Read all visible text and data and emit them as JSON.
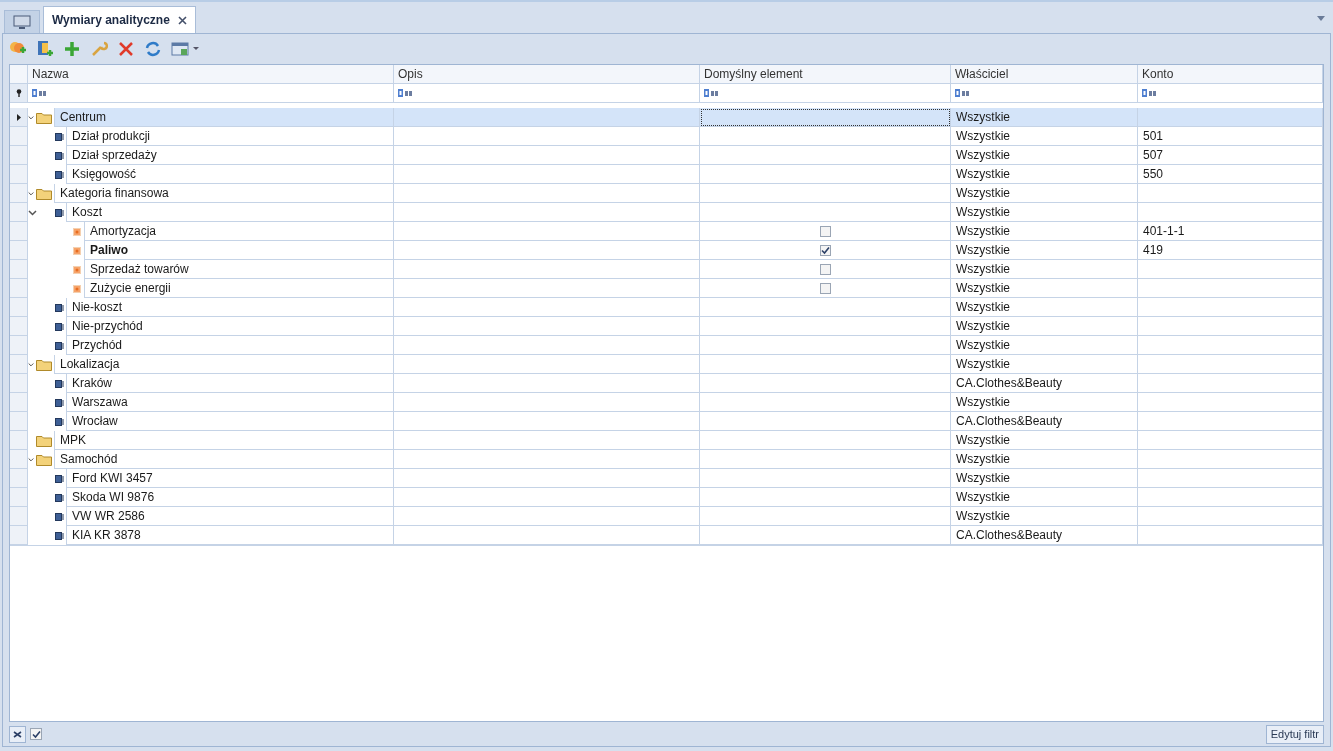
{
  "tabs": [
    {
      "kind": "home",
      "selected": false
    },
    {
      "kind": "document",
      "label": "Wymiary analityczne",
      "selected": true
    }
  ],
  "columns": [
    "Nazwa",
    "Opis",
    "Domyślny element",
    "Właściciel",
    "Konto"
  ],
  "tree": [
    {
      "kind": "folder",
      "name": "Centrum",
      "owner": "Wszystkie",
      "selected": true,
      "expanded": true,
      "children": [
        {
          "kind": "element",
          "name": "Dział produkcji",
          "owner": "Wszystkie",
          "account": "501",
          "selected": false
        },
        {
          "kind": "element",
          "name": "Dział sprzedaży",
          "owner": "Wszystkie",
          "account": "507",
          "selected": false
        },
        {
          "kind": "element",
          "name": "Księgowość",
          "owner": "Wszystkie",
          "account": "550",
          "selected": false
        }
      ]
    },
    {
      "kind": "folder",
      "name": "Kategoria finansowa",
      "owner": "Wszystkie",
      "selected": false,
      "expanded": true,
      "children": [
        {
          "kind": "element",
          "name": "Koszt",
          "owner": "Wszystkie",
          "selected": false,
          "expanded": true,
          "children": [
            {
              "kind": "leaf",
              "name": "Amortyzacja",
              "owner": "Wszystkie",
              "account": "401-1-1",
              "selected": false,
              "default": false
            },
            {
              "kind": "leaf",
              "name": "Paliwo",
              "owner": "Wszystkie",
              "account": "419",
              "selected": false,
              "default": true
            },
            {
              "kind": "leaf",
              "name": "Sprzedaż towarów",
              "owner": "Wszystkie",
              "selected": false,
              "default": false
            },
            {
              "kind": "leaf",
              "name": "Zużycie energii",
              "owner": "Wszystkie",
              "selected": false,
              "default": false
            }
          ]
        },
        {
          "kind": "element",
          "name": "Nie-koszt",
          "owner": "Wszystkie",
          "selected": false
        },
        {
          "kind": "element",
          "name": "Nie-przychód",
          "owner": "Wszystkie",
          "selected": false
        },
        {
          "kind": "element",
          "name": "Przychód",
          "owner": "Wszystkie",
          "selected": false
        }
      ]
    },
    {
      "kind": "folder",
      "name": "Lokalizacja",
      "owner": "Wszystkie",
      "selected": false,
      "expanded": true,
      "children": [
        {
          "kind": "element",
          "name": "Kraków",
          "owner": "CA.Clothes&Beauty",
          "selected": false
        },
        {
          "kind": "element",
          "name": "Warszawa",
          "owner": "Wszystkie",
          "selected": false
        },
        {
          "kind": "element",
          "name": "Wrocław",
          "owner": "CA.Clothes&Beauty",
          "selected": false
        }
      ]
    },
    {
      "kind": "folder",
      "name": "MPK",
      "owner": "Wszystkie",
      "selected": false
    },
    {
      "kind": "folder",
      "name": "Samochód",
      "owner": "Wszystkie",
      "selected": false,
      "expanded": true,
      "children": [
        {
          "kind": "element",
          "name": "Ford KWI 3457",
          "owner": "Wszystkie",
          "selected": false
        },
        {
          "kind": "element",
          "name": "Skoda WI 9876",
          "owner": "Wszystkie",
          "selected": false
        },
        {
          "kind": "element",
          "name": "VW WR 2586",
          "owner": "Wszystkie",
          "selected": false
        },
        {
          "kind": "element",
          "name": "KIA KR 3878",
          "owner": "CA.Clothes&Beauty",
          "selected": false
        }
      ]
    }
  ],
  "footer": {
    "filter_enabled": true,
    "edit_filter": "Edytuj filtr"
  }
}
